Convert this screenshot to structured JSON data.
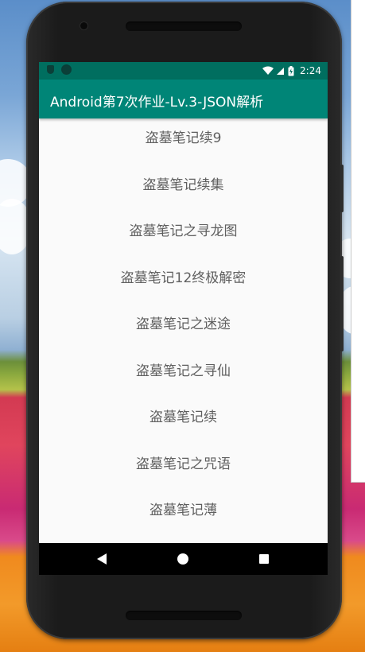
{
  "status_bar": {
    "time": "2:24",
    "icons": [
      "shield-icon",
      "circle-icon",
      "wifi-icon",
      "battery-charging-icon"
    ]
  },
  "app_bar": {
    "title": "Android第7次作业-Lv.3-JSON解析"
  },
  "list": {
    "items": [
      "盗墓笔记续9",
      "盗墓笔记续集",
      "盗墓笔记之寻龙图",
      "盗墓笔记12终极解密",
      "盗墓笔记之迷途",
      "盗墓笔记之寻仙",
      "盗墓笔记续",
      "盗墓笔记之咒语",
      "盗墓笔记薄"
    ]
  },
  "nav_bar": {
    "icons": [
      "back-icon",
      "home-icon",
      "recent-apps-icon"
    ]
  },
  "colors": {
    "status_bar": "#006e5f",
    "app_bar": "#008577",
    "list_background": "#fafafa",
    "list_text": "#5f5f5f",
    "nav_bar": "#000000"
  }
}
